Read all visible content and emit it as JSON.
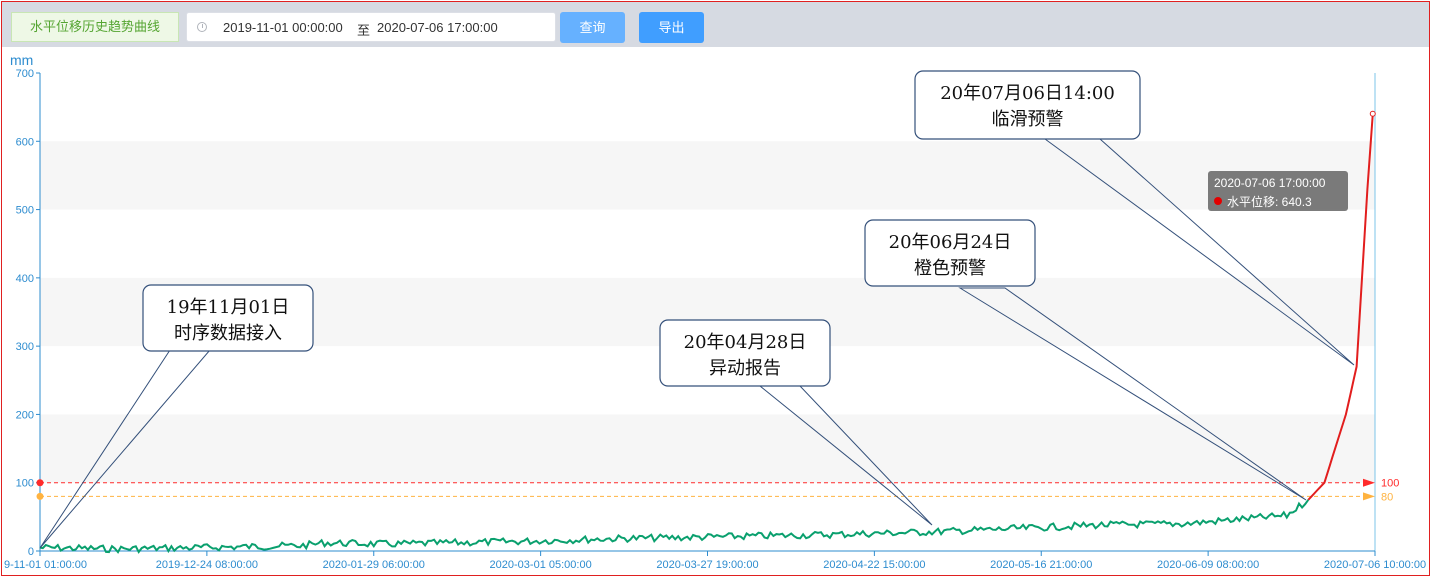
{
  "toolbar": {
    "title": "水平位移历史趋势曲线",
    "date_start": "2019-11-01 00:00:00",
    "date_separator": "至",
    "date_end": "2020-07-06 17:00:00",
    "query_label": "查询",
    "export_label": "导出"
  },
  "chart_data": {
    "type": "line",
    "unit": "mm",
    "ylim": [
      0,
      700
    ],
    "y_ticks": [
      "0",
      "100",
      "200",
      "300",
      "400",
      "500",
      "600",
      "700"
    ],
    "x_tick_labels": [
      "9-11-01 01:00:00",
      "2019-12-24 08:00:00",
      "2020-01-29 06:00:00",
      "2020-03-01 05:00:00",
      "2020-03-27 19:00:00",
      "2020-04-22 15:00:00",
      "2020-05-16 21:00:00",
      "2020-06-09 08:00:00",
      "2020-07-06 10:00:00"
    ],
    "x": [
      "2019-11-01",
      "2019-11-15",
      "2019-12-01",
      "2019-12-20",
      "2019-12-24",
      "2020-01-05",
      "2020-01-29",
      "2020-02-15",
      "2020-03-01",
      "2020-03-27",
      "2020-04-15",
      "2020-04-28",
      "2020-05-16",
      "2020-06-01",
      "2020-06-09",
      "2020-06-20",
      "2020-06-24",
      "2020-06-27",
      "2020-06-29",
      "2020-07-01",
      "2020-07-03",
      "2020-07-04",
      "2020-07-05",
      "2020-07-06"
    ],
    "series": [
      {
        "values": [
          5,
          3,
          5,
          8,
          12,
          10,
          14,
          18,
          20,
          24,
          28,
          32,
          38,
          40,
          45,
          52,
          75,
          100,
          150,
          200,
          270,
          400,
          530,
          640.3
        ]
      }
    ],
    "reference_lines": [
      {
        "label": "100",
        "value": 100,
        "color": "#ff2b2b"
      },
      {
        "label": "80",
        "value": 80,
        "color": "#ffb340"
      }
    ],
    "line_colors": {
      "normal": "#0aa06e",
      "warning": "#e21e1e"
    },
    "grid": true
  },
  "annotations": [
    {
      "line1": "19年11月01日",
      "line2": "时序数据接入"
    },
    {
      "line1": "20年04月28日",
      "line2": "异动报告"
    },
    {
      "line1": "20年06月24日",
      "line2": "橙色预警"
    },
    {
      "line1": "20年07月06日14:00",
      "line2": "临滑预警"
    }
  ],
  "tooltip": {
    "time": "2020-07-06 17:00:00",
    "series_label": "水平位移: 640.3"
  }
}
